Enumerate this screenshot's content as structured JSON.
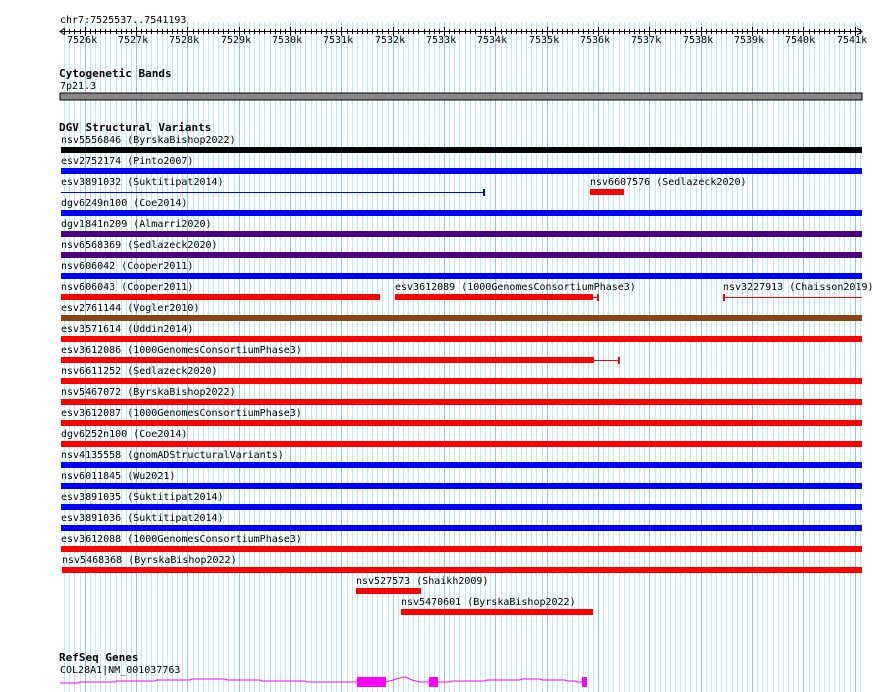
{
  "view": {
    "chrom": "chr7",
    "start": 7525537,
    "end": 7541193,
    "location_label": "chr7:7525537..7541193"
  },
  "ruler": {
    "tick_labels": [
      "7526k",
      "7527k",
      "7528k",
      "7529k",
      "7530k",
      "7531k",
      "7532k",
      "7533k",
      "7534k",
      "7535k",
      "7536k",
      "7537k",
      "7538k",
      "7539k",
      "7540k",
      "7541k"
    ]
  },
  "colors": {
    "grid_minor": "#b4eeee",
    "grid_major": "#8ec8f0",
    "band": "#888888",
    "gene": "#ff00ff"
  },
  "cytoband": {
    "title": "Cytogenetic Bands",
    "band_label": "7p21.3"
  },
  "dgv": {
    "title": "DGV Structural Variants",
    "rows": [
      [
        {
          "label": "nsv5556846 (ByrskaBishop2022)",
          "start": 7525537,
          "end": 7541193,
          "color": "#000000"
        }
      ],
      [
        {
          "label": "esv2752174 (Pinto2007)",
          "start": 7525537,
          "end": 7541193,
          "color": "#0000ff"
        }
      ],
      [
        {
          "label": "esv3891032 (Suktitipat2014)",
          "thin_start": 7525537,
          "thin_end": 7533778,
          "color": "#0000ff",
          "end_tick": true
        },
        {
          "label": "nsv6607576 (Sedlazeck2020)",
          "start": 7535843,
          "end": 7536505,
          "color": "#ff0000"
        }
      ],
      [
        {
          "label": "dgv6249n100 (Coe2014)",
          "start": 7525537,
          "end": 7541193,
          "color": "#0000ff"
        }
      ],
      [
        {
          "label": "dgv1841n209 (Almarri2020)",
          "start": 7525537,
          "end": 7541193,
          "color": "#4b0082"
        }
      ],
      [
        {
          "label": "nsv6568369 (Sedlazeck2020)",
          "start": 7525537,
          "end": 7541193,
          "color": "#4b0082"
        }
      ],
      [
        {
          "label": "nsv606042 (Cooper2011)",
          "start": 7525537,
          "end": 7541193,
          "color": "#0000ff"
        }
      ],
      [
        {
          "label": "nsv606043 (Cooper2011)",
          "start": 7525537,
          "end": 7531752,
          "color": "#ff0000"
        },
        {
          "label": "esv3612089 (1000GenomesConsortiumPhase3)",
          "start": 7532044,
          "end": 7535901,
          "thin_end": 7535999,
          "color": "#ff0000",
          "end_tick": true
        },
        {
          "label": "nsv3227913 (Chaisson2019)",
          "thin_start": 7538434,
          "thin_end": 7541193,
          "color": "#ff0000",
          "start_tick": true
        }
      ],
      [
        {
          "label": "esv2761144 (Vogler2010)",
          "start": 7525537,
          "end": 7541193,
          "color": "#8b4513"
        }
      ],
      [
        {
          "label": "esv3571614 (Uddin2014)",
          "start": 7525537,
          "end": 7541193,
          "color": "#ff0000"
        }
      ],
      [
        {
          "label": "esv3612086 (1000GenomesConsortiumPhase3)",
          "start": 7525537,
          "end": 7535921,
          "thin_end": 7536408,
          "color": "#ff0000",
          "end_tick": true
        }
      ],
      [
        {
          "label": "nsv6611252 (Sedlazeck2020)",
          "start": 7525537,
          "end": 7541193,
          "color": "#ff0000"
        }
      ],
      [
        {
          "label": "nsv5467072 (ByrskaBishop2022)",
          "start": 7525537,
          "end": 7541193,
          "color": "#ff0000"
        }
      ],
      [
        {
          "label": "esv3612087 (1000GenomesConsortiumPhase3)",
          "start": 7525537,
          "end": 7541193,
          "color": "#ff0000"
        }
      ],
      [
        {
          "label": "dgv6252n100 (Coe2014)",
          "start": 7525537,
          "end": 7541193,
          "color": "#ff0000"
        }
      ],
      [
        {
          "label": "nsv4135558 (gnomADStructuralVariants)",
          "start": 7525537,
          "end": 7541193,
          "color": "#0000ff"
        }
      ],
      [
        {
          "label": "nsv6011845 (Wu2021)",
          "start": 7525537,
          "end": 7541193,
          "color": "#0000ff"
        }
      ],
      [
        {
          "label": "esv3891035 (Suktitipat2014)",
          "start": 7525537,
          "end": 7541193,
          "color": "#0000ff"
        }
      ],
      [
        {
          "label": "esv3891036 (Suktitipat2014)",
          "start": 7525537,
          "end": 7541193,
          "color": "#0000ff"
        }
      ],
      [
        {
          "label": "esv3612088 (1000GenomesConsortiumPhase3)",
          "start": 7525537,
          "end": 7541193,
          "color": "#ff0000"
        }
      ],
      [
        {
          "label": "nsv5468368 (ByrskaBishop2022)",
          "start": 7525556,
          "end": 7541193,
          "color": "#ff0000"
        }
      ],
      [
        {
          "label": "nsv527573 (Shaikh2009)",
          "start": 7531284,
          "end": 7532551,
          "color": "#ff0000"
        }
      ],
      [
        {
          "label": "nsv5470601 (ByrskaBishop2022)",
          "start": 7532161,
          "end": 7535901,
          "color": "#ff0000"
        }
      ]
    ]
  },
  "refseq": {
    "title": "RefSeq Genes",
    "gene_label": "COL28A1|NM_001037763",
    "exons": [
      [
        7531304,
        7531869
      ],
      [
        7532706,
        7532881
      ],
      [
        7535687,
        7535784
      ]
    ]
  }
}
